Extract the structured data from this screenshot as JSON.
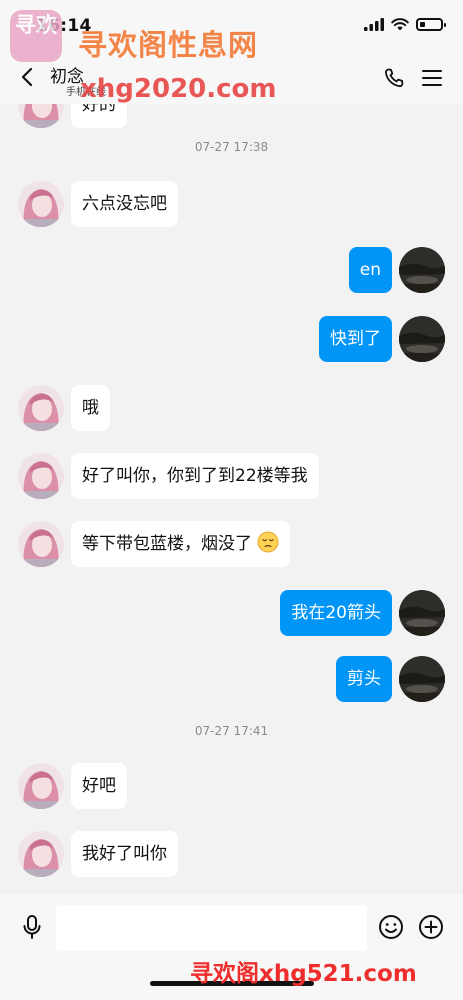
{
  "status_bar": {
    "time": "16:14",
    "battery_level": 0.25
  },
  "header": {
    "contact_name": "初念",
    "contact_subtitle": "手机在线",
    "icons": [
      "back-icon",
      "phone-icon",
      "menu-icon"
    ]
  },
  "watermark": {
    "logo_text": "寻欢",
    "title": "寻欢阁性息网",
    "url": "xhg2020.com",
    "bottom": "寻欢阁xhg521.com"
  },
  "messages": [
    {
      "type": "in",
      "text": "好的"
    },
    {
      "type": "time",
      "text": "07-27 17:38"
    },
    {
      "type": "in",
      "text": "六点没忘吧"
    },
    {
      "type": "out",
      "text": "en"
    },
    {
      "type": "out",
      "text": "快到了"
    },
    {
      "type": "in",
      "text": "哦"
    },
    {
      "type": "in",
      "text": "好了叫你，你到了到22楼等我"
    },
    {
      "type": "in",
      "text": "等下带包蓝楼，烟没了",
      "emoji": "sad-face-emoji"
    },
    {
      "type": "out",
      "text": "我在20箭头"
    },
    {
      "type": "out",
      "text": "剪头"
    },
    {
      "type": "time",
      "text": "07-27 17:41"
    },
    {
      "type": "in",
      "text": "好吧"
    },
    {
      "type": "in",
      "text": "我好了叫你"
    }
  ],
  "input_bar": {
    "placeholder": "",
    "icons": [
      "microphone-icon",
      "emoji-icon",
      "plus-icon"
    ]
  },
  "colors": {
    "outgoing_bubble": "#0095f6",
    "incoming_bubble": "#ffffff",
    "background": "#f2f2f2",
    "watermark_orange": "#f37c3a",
    "watermark_red": "#ee2d2d"
  }
}
